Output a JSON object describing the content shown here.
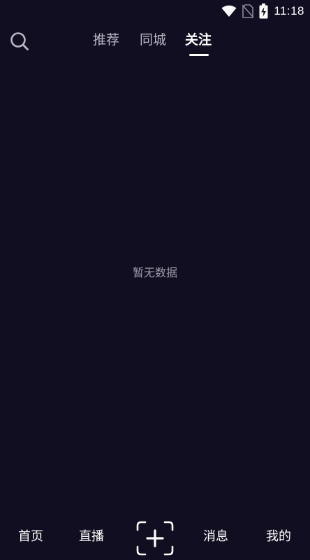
{
  "status_bar": {
    "time": "11:18",
    "icons": [
      "wifi-icon",
      "no-sim-icon",
      "battery-charging-icon"
    ]
  },
  "top_nav": {
    "search_icon": "search-icon",
    "tabs": [
      {
        "label": "推荐",
        "active": false
      },
      {
        "label": "同城",
        "active": false
      },
      {
        "label": "关注",
        "active": true
      }
    ]
  },
  "main": {
    "empty_message": "暂无数据"
  },
  "bottom_nav": {
    "items": [
      {
        "label": "首页"
      },
      {
        "label": "直播"
      },
      {
        "label": "消息"
      },
      {
        "label": "我的"
      }
    ],
    "add_icon": "plus-scan-icon"
  },
  "colors": {
    "background": "#120e22",
    "text_primary": "#ffffff",
    "text_secondary": "#b9b7c4",
    "text_muted": "#9c9aa8"
  }
}
